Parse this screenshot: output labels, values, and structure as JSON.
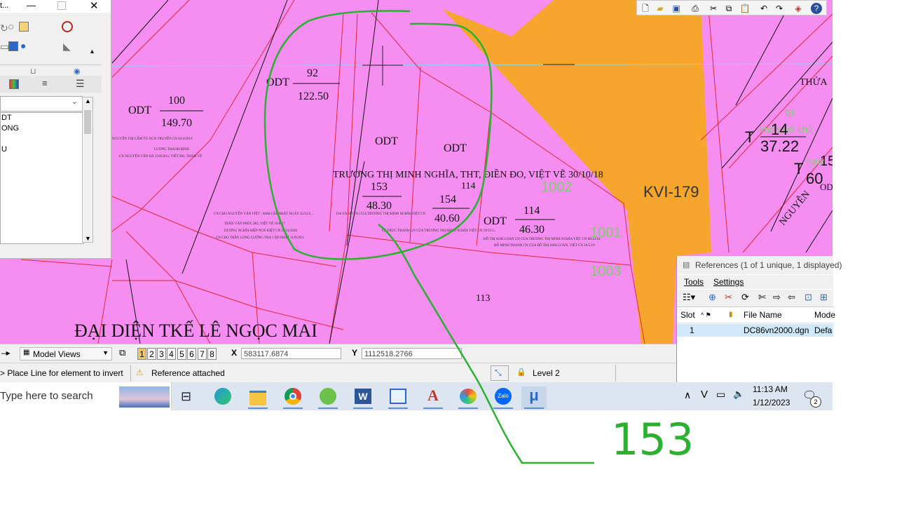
{
  "left_panel": {
    "title_fragment": "t...",
    "level_items": [
      "DT",
      "ONG",
      "",
      "U"
    ]
  },
  "map": {
    "parcels": [
      {
        "use": "ODT",
        "number": "92",
        "area": "122.50"
      },
      {
        "use": "ODT",
        "number": "100",
        "area": "149.70"
      },
      {
        "use": "",
        "number": "153",
        "area": "48.30"
      },
      {
        "use": "",
        "number": "154",
        "area": "40.60"
      },
      {
        "use": "ODT",
        "number": "114",
        "area": "46.30"
      }
    ],
    "labels": {
      "odt_a": "ODT",
      "odt_b": "ODT",
      "num_114": "114",
      "num_113": "113",
      "kvi": "KVI-179",
      "thua": "THỬA",
      "owner_line": "TRƯƠNG THỊ MINH NGHĨA, THT, ĐIỀN ĐO, VIỆT VẼ 30/10/18",
      "rep_line": "ĐẠI DIỆN TKẾ LÊ NGỌC MAI",
      "green_1002": "1002",
      "green_1001": "1001",
      "green_1003": "1003",
      "green_63": "63",
      "khong_ro_chu": "không rõ chủ",
      "big_14": "14",
      "big_3722": "37.22",
      "big_t1": "T",
      "big_t2": "T",
      "big_60": "60",
      "big_15": "15",
      "nguyen": "NGUYỄN",
      "od": "OD",
      "ngu": "nguy",
      "small_notes": [
        "NGUYỄN THỊ CẨM TÚ-NCN TRUYỀN CN 02/4/2019",
        "LƯƠNG THANH BÌNH",
        "CN NGUYỄN VĂN HÀ 23/8/2011, VIỆT ĐO, THÁM VẼ",
        "CN CHO NGUYỄN VĂN VIỆT - ANH CẬP NHẬT NGÀY 15/12/2...",
        "TRẦN VĂN PHÚC ĐO, VIỆT VẼ 16/8/17",
        "DƯƠNG NGHĨA HIỆP NCN KIỆT CN 25/11/2020",
        "CN CHO TRẦN LONG CƯỜNG TRẢ CẬP NHẬT 11/6/2021",
        "DA VÀ SỬ CN CỦA TRƯƠNG THỊ MINH NGHĨA VIỆT CN",
        "LÊ TRỰC THANH CN CỦA TRƯƠNG THỊ MINH NGHĨA VIỆT CN 19/11/2...",
        "ĐỖ THỊ ANH LOAN CN CỦA TRƯƠNG THỊ MINH NGHĨA VIỆT CN 08/12/18",
        "HỒ MINH THANH CN CỦA ĐỖ THỊ ANH LOAN, VIỆT CN 16/5/19"
      ]
    },
    "annotation": "153"
  },
  "references": {
    "title": "References (1 of 1 unique, 1 displayed)",
    "menu": [
      "Tools",
      "Settings"
    ],
    "columns": [
      "Slot",
      "File Name",
      "Mode"
    ],
    "rows": [
      {
        "slot": "1",
        "file_name": "DC86vn2000.dgn",
        "mode": "Defa"
      }
    ]
  },
  "status": {
    "view_dropdown": "Model Views",
    "view_numbers": [
      "1",
      "2",
      "3",
      "4",
      "5",
      "6",
      "7",
      "8"
    ],
    "x_label": "X",
    "x_value": "583117.6874",
    "y_label": "Y",
    "y_value": "1112518.2766",
    "prompt": "> Place Line for element to invert",
    "message": "Reference attached",
    "level": "Level 2"
  },
  "taskbar": {
    "search_placeholder": "Type here to search",
    "time": "11:13 AM",
    "date": "1/12/2023",
    "notification_count": "2",
    "apps": [
      "task-view",
      "edge",
      "file-explorer",
      "chrome",
      "vietnam-app",
      "word",
      "ultraviewer",
      "autocad",
      "paint",
      "zalo",
      "microstation"
    ]
  },
  "colors": {
    "map_pink": "#f58ef0",
    "road_orange": "#f6a62c",
    "boundary_red": "#e0283c",
    "annotation_green": "#2bb02f"
  }
}
